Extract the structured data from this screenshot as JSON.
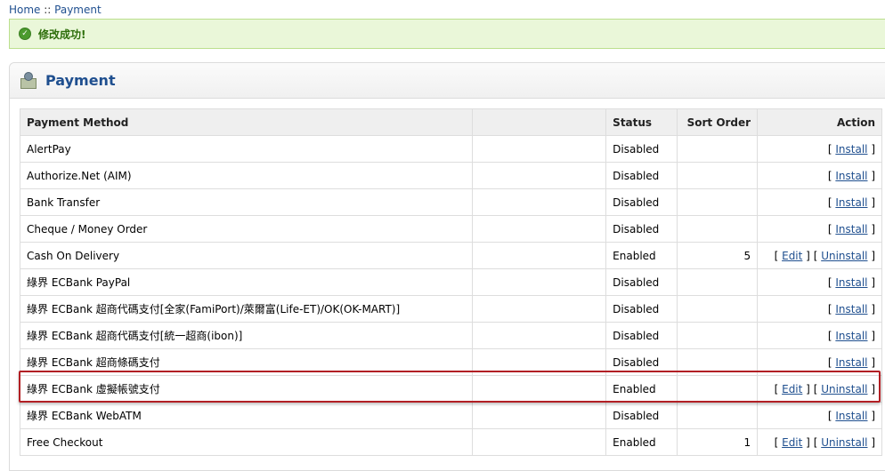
{
  "breadcrumb": {
    "home": "Home",
    "sep": " :: ",
    "current": "Payment"
  },
  "alert": {
    "message": "修改成功!",
    "icon": "check-circle-icon"
  },
  "box": {
    "title": "Payment",
    "icon": "payment-icon"
  },
  "table": {
    "headers": {
      "method": "Payment Method",
      "blank": "",
      "status": "Status",
      "sort": "Sort Order",
      "action": "Action"
    },
    "rows": [
      {
        "method": "AlertPay",
        "status": "Disabled",
        "sort": "",
        "actions": [
          "Install"
        ]
      },
      {
        "method": "Authorize.Net (AIM)",
        "status": "Disabled",
        "sort": "",
        "actions": [
          "Install"
        ]
      },
      {
        "method": "Bank Transfer",
        "status": "Disabled",
        "sort": "",
        "actions": [
          "Install"
        ]
      },
      {
        "method": "Cheque / Money Order",
        "status": "Disabled",
        "sort": "",
        "actions": [
          "Install"
        ]
      },
      {
        "method": "Cash On Delivery",
        "status": "Enabled",
        "sort": "5",
        "actions": [
          "Edit",
          "Uninstall"
        ]
      },
      {
        "method": "綠界 ECBank PayPal",
        "status": "Disabled",
        "sort": "",
        "actions": [
          "Install"
        ]
      },
      {
        "method": "綠界 ECBank 超商代碼支付[全家(FamiPort)/萊爾富(Life-ET)/OK(OK-MART)]",
        "status": "Disabled",
        "sort": "",
        "actions": [
          "Install"
        ]
      },
      {
        "method": "綠界 ECBank 超商代碼支付[統一超商(ibon)]",
        "status": "Disabled",
        "sort": "",
        "actions": [
          "Install"
        ]
      },
      {
        "method": "綠界 ECBank 超商條碼支付",
        "status": "Disabled",
        "sort": "",
        "actions": [
          "Install"
        ]
      },
      {
        "method": "綠界 ECBank 虛擬帳號支付",
        "status": "Enabled",
        "sort": "",
        "actions": [
          "Edit",
          "Uninstall"
        ]
      },
      {
        "method": "綠界 ECBank WebATM",
        "status": "Disabled",
        "sort": "",
        "actions": [
          "Install"
        ]
      },
      {
        "method": "Free Checkout",
        "status": "Enabled",
        "sort": "1",
        "actions": [
          "Edit",
          "Uninstall"
        ]
      }
    ]
  },
  "colors": {
    "link": "#1f4f8f",
    "success_bg": "#eaf7d9",
    "highlight": "#b21f24"
  }
}
